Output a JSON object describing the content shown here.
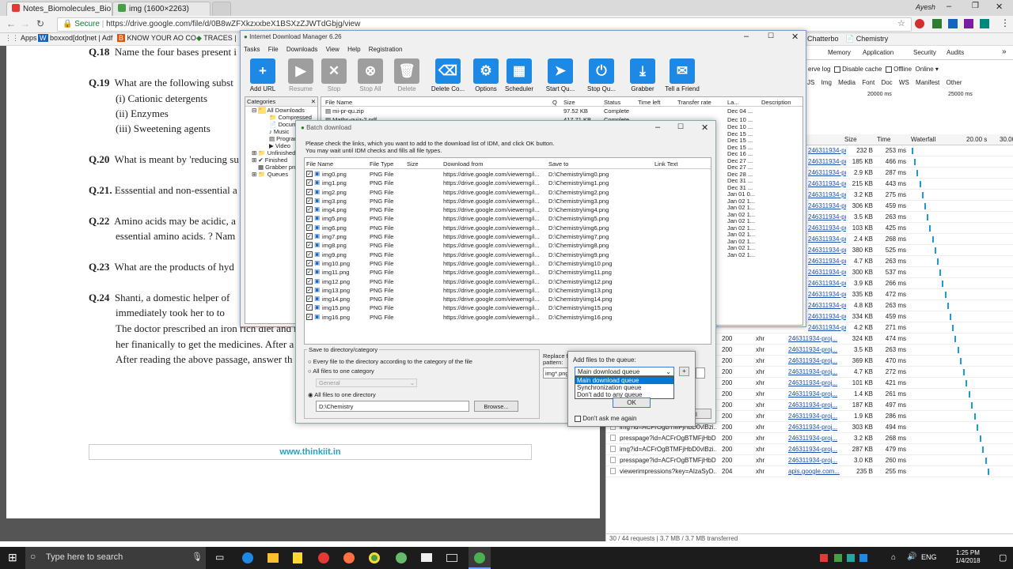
{
  "browser": {
    "tabs": [
      {
        "label": "Notes_Biomolecules_Bio",
        "icon": "pdf-icon",
        "color": "#e53935"
      },
      {
        "label": "img (1600×2263)",
        "icon": "image-icon",
        "color": "#43a047"
      }
    ],
    "user": "Ayesh",
    "url_scheme": "Secure",
    "url": "https://drive.google.com/file/d/0B8wZFXkzxxbeX1BSXzZJWTdGbjg/view",
    "bookmarks": [
      "Apps",
      "boxxod[dot]net | Adf",
      "KNOW YOUR AO CO",
      "TRACES |"
    ]
  },
  "document": {
    "questions": [
      {
        "num": "Q.18",
        "text": "Name the four bases present i"
      },
      {
        "num": "Q.19",
        "text": "What are the following subst",
        "subs": [
          "(i) Cationic detergents",
          "(ii) Enzymes",
          "(iii) Sweetening agents"
        ]
      },
      {
        "num": "Q.20",
        "text": "What is meant by 'reducing su"
      },
      {
        "num": "Q.21.",
        "text": "Esssential and non-essential a"
      },
      {
        "num": "Q.22",
        "text": "Amino acids may be acidic, a",
        "cont": "essential amino acids. ? Nam"
      },
      {
        "num": "Q.23",
        "text": "What are the products of hyd"
      },
      {
        "num": "Q.24",
        "text": "Shanti, a domestic helper of",
        "cont_lines": [
          "immediately took her to to",
          "The doctor prescribed an iron rich diet and m",
          "her finanically to get the medicines. After a",
          "After reading the above passage, answer th"
        ]
      }
    ],
    "footer_link": "www.thinkiit.in"
  },
  "devtools": {
    "tabs": [
      "Memory",
      "Application",
      "Security",
      "Audits"
    ],
    "options": [
      "erve log",
      "Disable cache",
      "Offline",
      "Online"
    ],
    "filter_types": [
      "JS",
      "Img",
      "Media",
      "Font",
      "Doc",
      "WS",
      "Manifest",
      "Other"
    ],
    "timeline_ticks": [
      "20000 ms",
      "25000 ms"
    ],
    "columns": [
      "Size",
      "Time",
      "Waterfall",
      "20.00 s",
      "30.00"
    ],
    "top_tabs": [
      "Chatterbo",
      "Chemistry"
    ],
    "rows_top": [
      {
        "initiator": "246311934-proj...",
        "size": "232 B",
        "time": "253 ms"
      },
      {
        "initiator": "246311934-proj...",
        "size": "185 KB",
        "time": "466 ms"
      },
      {
        "initiator": "246311934-proj...",
        "size": "2.9 KB",
        "time": "287 ms"
      },
      {
        "initiator": "246311934-proj...",
        "size": "215 KB",
        "time": "443 ms"
      },
      {
        "initiator": "246311934-proj...",
        "size": "3.2 KB",
        "time": "275 ms"
      },
      {
        "initiator": "246311934-proj...",
        "size": "306 KB",
        "time": "459 ms"
      },
      {
        "initiator": "246311934-proj...",
        "size": "3.5 KB",
        "time": "263 ms"
      },
      {
        "initiator": "246311934-proj...",
        "size": "103 KB",
        "time": "425 ms"
      },
      {
        "initiator": "246311934-proj...",
        "size": "2.4 KB",
        "time": "268 ms"
      },
      {
        "initiator": "246311934-proj...",
        "size": "380 KB",
        "time": "525 ms"
      },
      {
        "initiator": "246311934-proj...",
        "size": "4.7 KB",
        "time": "263 ms"
      },
      {
        "initiator": "246311934-proj...",
        "size": "300 KB",
        "time": "537 ms"
      },
      {
        "initiator": "246311934-proj...",
        "size": "3.9 KB",
        "time": "266 ms"
      },
      {
        "initiator": "246311934-proj...",
        "size": "335 KB",
        "time": "472 ms"
      },
      {
        "initiator": "246311934-proj...",
        "size": "4.8 KB",
        "time": "263 ms"
      },
      {
        "initiator": "246311934-proj...",
        "size": "334 KB",
        "time": "459 ms"
      },
      {
        "initiator": "246311934-proj...",
        "size": "4.2 KB",
        "time": "271 ms"
      }
    ],
    "rows_bottom": [
      {
        "name": "",
        "status": "200",
        "type": "xhr",
        "initiator": "246311934-proj...",
        "size": "324 KB",
        "time": "474 ms"
      },
      {
        "name": "",
        "status": "200",
        "type": "xhr",
        "initiator": "246311934-proj...",
        "size": "3.5 KB",
        "time": "263 ms"
      },
      {
        "name": "",
        "status": "200",
        "type": "xhr",
        "initiator": "246311934-proj...",
        "size": "369 KB",
        "time": "470 ms"
      },
      {
        "name": "",
        "status": "200",
        "type": "xhr",
        "initiator": "246311934-proj...",
        "size": "4.7 KB",
        "time": "272 ms"
      },
      {
        "name": "",
        "status": "200",
        "type": "xhr",
        "initiator": "246311934-proj...",
        "size": "101 KB",
        "time": "421 ms"
      },
      {
        "name": "",
        "status": "200",
        "type": "xhr",
        "initiator": "246311934-proj...",
        "size": "1.4 KB",
        "time": "261 ms"
      },
      {
        "name": "",
        "status": "200",
        "type": "xhr",
        "initiator": "246311934-proj...",
        "size": "187 KB",
        "time": "497 ms"
      },
      {
        "name": "",
        "status": "200",
        "type": "xhr",
        "initiator": "246311934-proj...",
        "size": "1.9 KB",
        "time": "286 ms"
      },
      {
        "name": "img?id=ACFrOgBTMFjHbD0vlBzi...",
        "status": "200",
        "type": "xhr",
        "initiator": "246311934-proj...",
        "size": "303 KB",
        "time": "494 ms"
      },
      {
        "name": "presspage?id=ACFrOgBTMFjHbD...",
        "status": "200",
        "type": "xhr",
        "initiator": "246311934-proj...",
        "size": "3.2 KB",
        "time": "268 ms"
      },
      {
        "name": "img?id=ACFrOgBTMFjHbD0vlBzi...",
        "status": "200",
        "type": "xhr",
        "initiator": "246311934-proj...",
        "size": "287 KB",
        "time": "479 ms"
      },
      {
        "name": "presspage?id=ACFrOgBTMFjHbD...",
        "status": "200",
        "type": "xhr",
        "initiator": "246311934-proj...",
        "size": "3.0 KB",
        "time": "260 ms"
      },
      {
        "name": "viewerimpressions?key=AIzaSyD...",
        "status": "204",
        "type": "xhr",
        "initiator": "apis.google.com...",
        "size": "235 B",
        "time": "255 ms"
      }
    ],
    "status_bar": "30 / 44 requests  |  3.7 MB / 3.7 MB transferred"
  },
  "idm": {
    "title": "Internet Download Manager 6.26",
    "menu": [
      "Tasks",
      "File",
      "Downloads",
      "View",
      "Help",
      "Registration"
    ],
    "toolbar": [
      {
        "label": "Add URL",
        "icon": "plus-icon",
        "enabled": true
      },
      {
        "label": "Resume",
        "icon": "play-icon",
        "enabled": false
      },
      {
        "label": "Stop",
        "icon": "x-icon",
        "enabled": false
      },
      {
        "label": "Stop All",
        "icon": "stop-all-icon",
        "enabled": false
      },
      {
        "label": "Delete",
        "icon": "trash-icon",
        "enabled": false
      },
      {
        "label": "Delete Co...",
        "icon": "delete-completed-icon",
        "enabled": true
      },
      {
        "label": "Options",
        "icon": "gear-icon",
        "enabled": true
      },
      {
        "label": "Scheduler",
        "icon": "calendar-icon",
        "enabled": true
      },
      {
        "label": "Start Qu...",
        "icon": "start-queue-icon",
        "enabled": true
      },
      {
        "label": "Stop Qu...",
        "icon": "stop-queue-icon",
        "enabled": true
      },
      {
        "label": "Grabber",
        "icon": "grabber-icon",
        "enabled": true
      },
      {
        "label": "Tell a Friend",
        "icon": "chat-icon",
        "enabled": true
      }
    ],
    "categories_header": "Categories",
    "categories": [
      "All Downloads",
      "Compressed",
      "Docume",
      "Music",
      "Program",
      "Video",
      "Unfinished",
      "Finished",
      "Grabber pro",
      "Queues"
    ],
    "list_columns": [
      "File Name",
      "Q",
      "Size",
      "Status",
      "Time left",
      "Transfer rate",
      "La...",
      "Description"
    ],
    "list_rows": [
      {
        "name": "mi-pr-qu.zip",
        "size": "97.52 KB",
        "status": "Complete",
        "date": "Dec 04 ..."
      },
      {
        "name": "Maths-quiz-2.pdf",
        "size": "417.71 KB",
        "status": "Complete",
        "date": "Dec 10 ..."
      }
    ],
    "right_dates": [
      "Dec 10 ...",
      "Dec 15 ...",
      "Dec 15 ...",
      "Dec 15 ...",
      "Dec 16 ...",
      "Dec 27 ...",
      "Dec 27 ...",
      "Dec 28 ...",
      "Dec 31 ...",
      "Dec 31 ...",
      "Jan 01 0...",
      "Jan 02 1...",
      "Jan 02 1...",
      "Jan 02 1...",
      "Jan 02 1...",
      "Jan 02 1...",
      "Jan 02 1...",
      "Jan 02 1...",
      "Jan 02 1...",
      "Jan 02 1..."
    ]
  },
  "batch": {
    "title": "Batch download",
    "instructions": [
      "Please check the links, which you want to add to the download list of IDM, and click OK button.",
      "You may wait until IDM checks and fills all file types."
    ],
    "columns": [
      "File Name",
      "File Type",
      "Size",
      "Download from",
      "Save to",
      "Link Text"
    ],
    "rows": [
      {
        "name": "img0.png",
        "type": "PNG File",
        "from": "https://drive.google.com/viewerng/i...",
        "to": "D:\\Chemistry\\img0.png"
      },
      {
        "name": "img1.png",
        "type": "PNG File",
        "from": "https://drive.google.com/viewerng/i...",
        "to": "D:\\Chemistry\\img1.png"
      },
      {
        "name": "img2.png",
        "type": "PNG File",
        "from": "https://drive.google.com/viewerng/i...",
        "to": "D:\\Chemistry\\img2.png"
      },
      {
        "name": "img3.png",
        "type": "PNG File",
        "from": "https://drive.google.com/viewerng/i...",
        "to": "D:\\Chemistry\\img3.png"
      },
      {
        "name": "img4.png",
        "type": "PNG File",
        "from": "https://drive.google.com/viewerng/i...",
        "to": "D:\\Chemistry\\img4.png"
      },
      {
        "name": "img5.png",
        "type": "PNG File",
        "from": "https://drive.google.com/viewerng/i...",
        "to": "D:\\Chemistry\\img5.png"
      },
      {
        "name": "img6.png",
        "type": "PNG File",
        "from": "https://drive.google.com/viewerng/i...",
        "to": "D:\\Chemistry\\img6.png"
      },
      {
        "name": "img7.png",
        "type": "PNG File",
        "from": "https://drive.google.com/viewerng/i...",
        "to": "D:\\Chemistry\\img7.png"
      },
      {
        "name": "img8.png",
        "type": "PNG File",
        "from": "https://drive.google.com/viewerng/i...",
        "to": "D:\\Chemistry\\img8.png"
      },
      {
        "name": "img9.png",
        "type": "PNG File",
        "from": "https://drive.google.com/viewerng/i...",
        "to": "D:\\Chemistry\\img9.png"
      },
      {
        "name": "img10.png",
        "type": "PNG File",
        "from": "https://drive.google.com/viewerng/i...",
        "to": "D:\\Chemistry\\img10.png"
      },
      {
        "name": "img11.png",
        "type": "PNG File",
        "from": "https://drive.google.com/viewerng/i...",
        "to": "D:\\Chemistry\\img11.png"
      },
      {
        "name": "img12.png",
        "type": "PNG File",
        "from": "https://drive.google.com/viewerng/i...",
        "to": "D:\\Chemistry\\img12.png"
      },
      {
        "name": "img13.png",
        "type": "PNG File",
        "from": "https://drive.google.com/viewerng/i...",
        "to": "D:\\Chemistry\\img13.png"
      },
      {
        "name": "img14.png",
        "type": "PNG File",
        "from": "https://drive.google.com/viewerng/i...",
        "to": "D:\\Chemistry\\img14.png"
      },
      {
        "name": "img15.png",
        "type": "PNG File",
        "from": "https://drive.google.com/viewerng/i...",
        "to": "D:\\Chemistry\\img15.png"
      },
      {
        "name": "img16.png",
        "type": "PNG File",
        "from": "https://drive.google.com/viewerng/i...",
        "to": "D:\\Chemistry\\img16.png"
      }
    ],
    "save_group": "Save to directory/category",
    "opt_every": "Every file to the directory according to the category of the file",
    "opt_category": "All files to one category",
    "category_value": "General",
    "opt_directory": "All files to one directory",
    "directory_value": "D:\\Chemistry",
    "browse_label": "Browse...",
    "replace_label": "Replace fi pattern:",
    "pattern_value": "img*.png",
    "cancel_fragment": "el"
  },
  "queue_popup": {
    "label": "Add files to the queue:",
    "selected": "Main download queue",
    "options": [
      "Main download queue",
      "Synchronization queue",
      "Don't add to any queue"
    ],
    "add_label": "+",
    "ok_label": "OK",
    "dont_ask": "Don't ask me again"
  },
  "taskbar": {
    "search_placeholder": "Type here to search",
    "lang": "ENG",
    "time": "1:25 PM",
    "date": "1/4/2018"
  }
}
